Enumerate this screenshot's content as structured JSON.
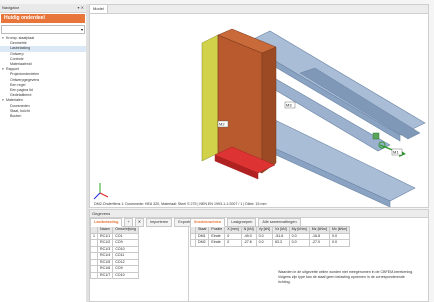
{
  "navigator": {
    "header": "Navigator",
    "header_icons": "▾ ✕",
    "title": "Huidig onderdeel",
    "select_value": "",
    "tree": [
      {
        "type": "group",
        "label": "Kromp. staafplaat"
      },
      {
        "type": "item",
        "label": "Geometrie"
      },
      {
        "type": "item",
        "label": "Lasbelasting",
        "selected": true
      },
      {
        "type": "item",
        "label": "Ontwerp"
      },
      {
        "type": "item",
        "label": "Controle"
      },
      {
        "type": "item",
        "label": "Materiaalenid"
      },
      {
        "type": "group",
        "label": "Rapport"
      },
      {
        "type": "item",
        "label": "Projectonderdelen"
      },
      {
        "type": "item",
        "label": "Ontwerpgegevens"
      },
      {
        "type": "item",
        "label": "Een regel"
      },
      {
        "type": "item",
        "label": "Een pagina lid"
      },
      {
        "type": "item",
        "label": "Gedetailleerd"
      },
      {
        "type": "group",
        "label": "Materialen"
      },
      {
        "type": "item",
        "label": "Doorsneden"
      },
      {
        "type": "item",
        "label": "Staal, bolcht"
      },
      {
        "type": "item",
        "label": "Bouten"
      }
    ]
  },
  "view": {
    "tab_label": "Model",
    "labels": {
      "m2": "M2",
      "m3": "M3",
      "m1": "M1"
    },
    "status": "DM2-Onderflens 1: Doorsnede: HEA 320, Materiaal: Steel S 275 | NEN EN 1993-1-1:2007 / 1 | Dikte: 15 mm",
    "colors": {
      "beam": "#8fa8c8",
      "plate": "#b85a2e",
      "green": "#2f9a2f",
      "red": "#d33",
      "yellow": "#e8d23a"
    }
  },
  "results": {
    "header": "Gegevens",
    "left_tabs": [
      "Lastbelasting",
      "+",
      "✕",
      "Importeren",
      "Exporteren"
    ],
    "left_table": {
      "columns": [
        "",
        "Naam",
        "Omschrijving"
      ],
      "rows": [
        [
          "1",
          "RC1/1",
          "CO1"
        ],
        [
          "",
          "RC1/2",
          "CO9"
        ],
        [
          "",
          "RC1/3",
          "CO10"
        ],
        [
          "",
          "RC1/4",
          "CO11"
        ],
        [
          "",
          "RC1/5",
          "CO12"
        ],
        [
          "",
          "RC1/6",
          "CO9"
        ],
        [
          "",
          "RC1/7",
          "CO10"
        ]
      ]
    },
    "right_tabs": [
      "Snedekrachten",
      "Lastgroepen",
      "Alle samenvattingen"
    ],
    "right_table": {
      "columns": [
        "",
        "Staaf",
        "Positie",
        "X [mm]",
        "N [kN]",
        "Vy [kN]",
        "Vz [kN]",
        "My [kNm]",
        "Mz [kNm]",
        "Mx [kNm]"
      ],
      "rows": [
        [
          "",
          "DM1",
          "Einde",
          "0",
          "-49.0",
          "0.0",
          "-51.6",
          "0.0",
          "-16.8",
          "0.0"
        ],
        [
          "",
          "DM2",
          "Einde",
          "0",
          "-27.6",
          "0.0",
          "63.3",
          "0.0",
          "-27.0",
          "0.0"
        ]
      ]
    },
    "note": "Waarden in de uitgezette cellen worden niet meegenomen in de CBFEM-berekening. Volgens zijn type kan de staaf geen belasting opnemen in de corresponderende richting."
  }
}
